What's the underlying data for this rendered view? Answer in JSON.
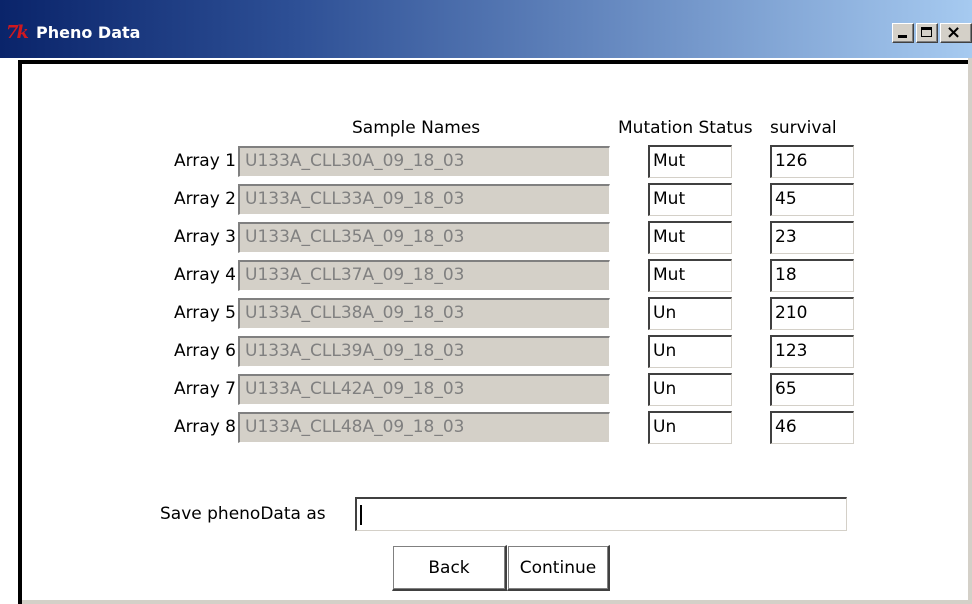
{
  "window": {
    "title": "Pheno Data"
  },
  "headers": {
    "sample_names": "Sample Names",
    "mutation_status": "Mutation Status",
    "survival": "survival"
  },
  "rows": [
    {
      "label": "Array 1",
      "sample": "U133A_CLL30A_09_18_03",
      "mutation": "Mut",
      "survival": "126"
    },
    {
      "label": "Array 2",
      "sample": "U133A_CLL33A_09_18_03",
      "mutation": "Mut",
      "survival": "45"
    },
    {
      "label": "Array 3",
      "sample": "U133A_CLL35A_09_18_03",
      "mutation": "Mut",
      "survival": "23"
    },
    {
      "label": "Array 4",
      "sample": "U133A_CLL37A_09_18_03",
      "mutation": "Mut",
      "survival": "18"
    },
    {
      "label": "Array 5",
      "sample": "U133A_CLL38A_09_18_03",
      "mutation": "Un",
      "survival": "210"
    },
    {
      "label": "Array 6",
      "sample": "U133A_CLL39A_09_18_03",
      "mutation": "Un",
      "survival": "123"
    },
    {
      "label": "Array 7",
      "sample": "U133A_CLL42A_09_18_03",
      "mutation": "Un",
      "survival": "65"
    },
    {
      "label": "Array 8",
      "sample": "U133A_CLL48A_09_18_03",
      "mutation": "Un",
      "survival": "46"
    }
  ],
  "save": {
    "label": "Save phenoData as",
    "value": ""
  },
  "buttons": {
    "back": "Back",
    "continue": "Continue"
  },
  "icons": {
    "app": "tk-feather-icon",
    "minimize": "minimize-icon",
    "maximize": "maximize-icon",
    "close": "close-icon"
  },
  "colors": {
    "titlebar_start": "#0a246a",
    "titlebar_end": "#a6caf0",
    "logo": "#d0181f"
  }
}
